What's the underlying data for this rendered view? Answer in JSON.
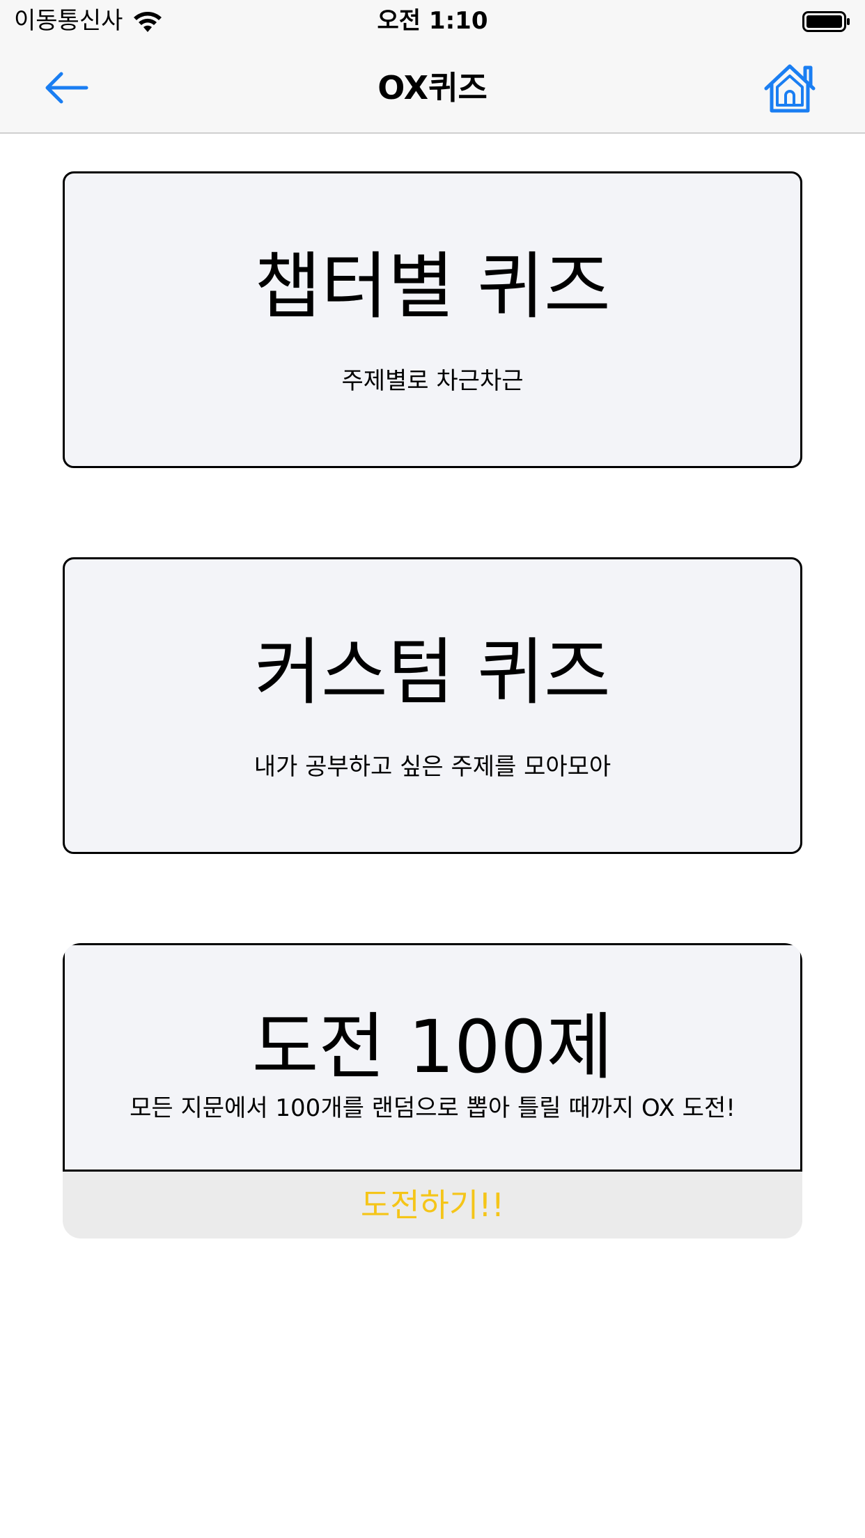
{
  "status_bar": {
    "carrier": "이동통신사",
    "time": "오전 1:10",
    "wifi_icon": "wifi-icon",
    "battery_icon": "battery-icon"
  },
  "nav": {
    "title": "OX퀴즈",
    "back_icon": "arrow-left-icon",
    "home_icon": "home-icon",
    "accent_color": "#1a7ef2"
  },
  "cards": [
    {
      "title": "챕터별 퀴즈",
      "subtitle": "주제별로 차근차근"
    },
    {
      "title": "커스텀 퀴즈",
      "subtitle": "내가 공부하고 싶은 주제를 모아모아"
    }
  ],
  "challenge": {
    "title": "도전 100제",
    "subtitle": "모든 지문에서 100개를 랜덤으로 뽑아 틀릴 때까지 OX 도전!",
    "button_label": "도전하기!!",
    "button_color": "#f5c518"
  }
}
